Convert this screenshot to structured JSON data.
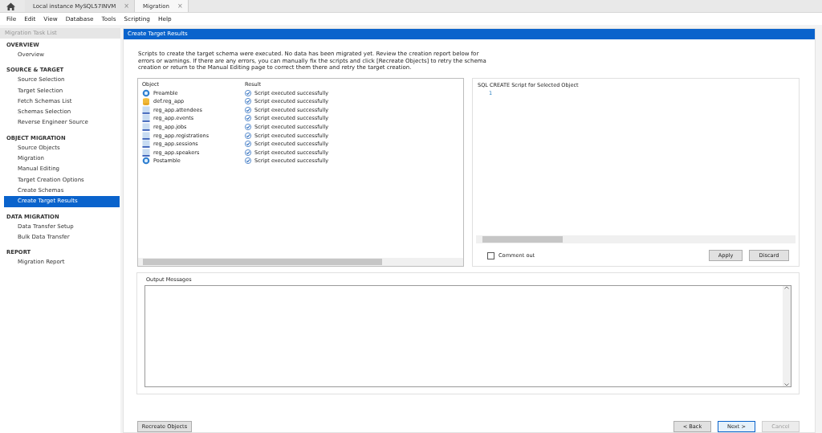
{
  "tabs": [
    {
      "kind": "home",
      "selected": false
    },
    {
      "kind": "document",
      "label": "Local instance MySQL57INVM",
      "close": "×",
      "selected": false
    },
    {
      "kind": "document",
      "label": "Migration",
      "close": "×",
      "selected": true
    }
  ],
  "menu": [
    "File",
    "Edit",
    "View",
    "Database",
    "Tools",
    "Scripting",
    "Help"
  ],
  "sidebar": {
    "title": "Migration Task List",
    "sections": [
      {
        "heading": "OVERVIEW",
        "items": [
          {
            "label": "Overview",
            "selected": false
          }
        ]
      },
      {
        "heading": "SOURCE & TARGET",
        "items": [
          {
            "label": "Source Selection",
            "selected": false
          },
          {
            "label": "Target Selection",
            "selected": false
          },
          {
            "label": "Fetch Schemas List",
            "selected": false
          },
          {
            "label": "Schemas Selection",
            "selected": false
          },
          {
            "label": "Reverse Engineer Source",
            "selected": false
          }
        ]
      },
      {
        "heading": "OBJECT MIGRATION",
        "items": [
          {
            "label": "Source Objects",
            "selected": false
          },
          {
            "label": "Migration",
            "selected": false
          },
          {
            "label": "Manual Editing",
            "selected": false
          },
          {
            "label": "Target Creation Options",
            "selected": false
          },
          {
            "label": "Create Schemas",
            "selected": false
          },
          {
            "label": "Create Target Results",
            "selected": true
          }
        ]
      },
      {
        "heading": "DATA MIGRATION",
        "items": [
          {
            "label": "Data Transfer Setup",
            "selected": false
          },
          {
            "label": "Bulk Data Transfer",
            "selected": false
          }
        ]
      },
      {
        "heading": "REPORT",
        "items": [
          {
            "label": "Migration Report",
            "selected": false
          }
        ]
      }
    ]
  },
  "page": {
    "title": "Create Target Results",
    "description": "Scripts to create the target schema were executed. No data has been migrated yet. Review the creation report below for errors or warnings. If there are any errors, you can manually fix the scripts and click [Recreate Objects] to retry the schema creation or return to the Manual Editing page to correct them there and retry the target creation.",
    "objects": {
      "columns": [
        "Object",
        "Result"
      ],
      "rows": [
        {
          "kind": "step",
          "name": "Preamble",
          "result": "Script executed successfully"
        },
        {
          "kind": "schema",
          "name": "def.reg_app",
          "result": "Script executed successfully"
        },
        {
          "kind": "table",
          "name": "reg_app.attendees",
          "result": "Script executed successfully"
        },
        {
          "kind": "table",
          "name": "reg_app.events",
          "result": "Script executed successfully"
        },
        {
          "kind": "table",
          "name": "reg_app.jobs",
          "result": "Script executed successfully"
        },
        {
          "kind": "table",
          "name": "reg_app.registrations",
          "result": "Script executed successfully"
        },
        {
          "kind": "table",
          "name": "reg_app.sessions",
          "result": "Script executed successfully"
        },
        {
          "kind": "table",
          "name": "reg_app.speakers",
          "result": "Script executed successfully"
        },
        {
          "kind": "step",
          "name": "Postamble",
          "result": "Script executed successfully"
        }
      ]
    },
    "script": {
      "title": "SQL CREATE Script for Selected Object",
      "line_numbers": [
        "1"
      ]
    },
    "comment_out": {
      "label": "Comment out",
      "checked": false
    },
    "script_buttons": [
      "Apply",
      "Discard"
    ],
    "output": {
      "title": "Output Messages"
    },
    "recreate_button": "Recreate Objects",
    "nav_buttons": [
      {
        "label": "< Back",
        "disabled": false,
        "focused": false
      },
      {
        "label": "Next >",
        "disabled": false,
        "focused": true
      },
      {
        "label": "Cancel",
        "disabled": true,
        "focused": false
      }
    ]
  }
}
